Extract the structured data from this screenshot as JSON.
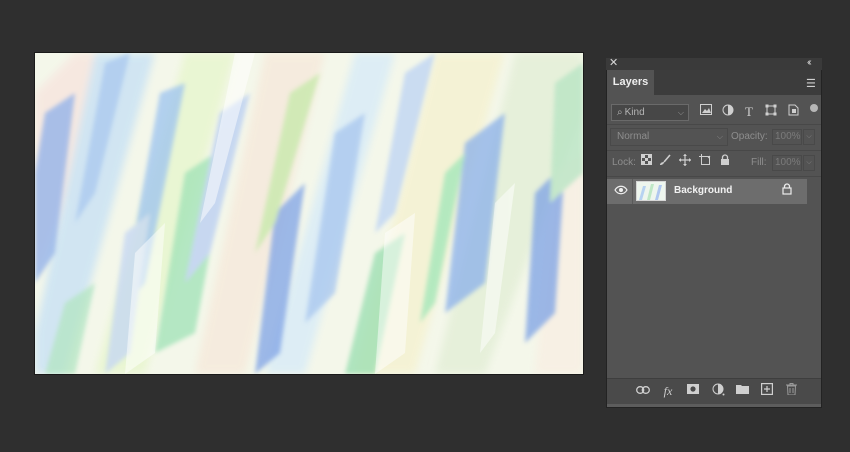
{
  "panel": {
    "close_glyph": "✕",
    "collapse_glyph": "‹‹",
    "tab_label": "Layers",
    "menu_icon": "hamburger-menu-icon"
  },
  "filter": {
    "kind_label": "Kind",
    "icons": [
      "image-filter-icon",
      "adjustment-filter-icon",
      "type-filter-icon",
      "shape-filter-icon",
      "smart-object-filter-icon"
    ]
  },
  "blend": {
    "mode": "Normal",
    "opacity_label": "Opacity:",
    "opacity_value": "100%",
    "fill_label": "Fill:",
    "fill_value": "100%"
  },
  "lock": {
    "label": "Lock:",
    "icons": [
      "lock-transparent-pixels-icon",
      "lock-image-pixels-icon",
      "lock-position-icon",
      "lock-artboard-icon",
      "lock-all-icon"
    ]
  },
  "layers": [
    {
      "name": "Background",
      "visible": true,
      "locked": true
    }
  ],
  "bottom_icons": [
    "link-layers-icon",
    "fx-icon",
    "add-mask-icon",
    "new-adjustment-layer-icon",
    "new-group-icon",
    "new-layer-icon",
    "delete-layer-icon"
  ],
  "colors": {
    "app_background": "#2f2f2f",
    "panel_background": "#535353",
    "selected_layer": "#6d6d6d"
  }
}
